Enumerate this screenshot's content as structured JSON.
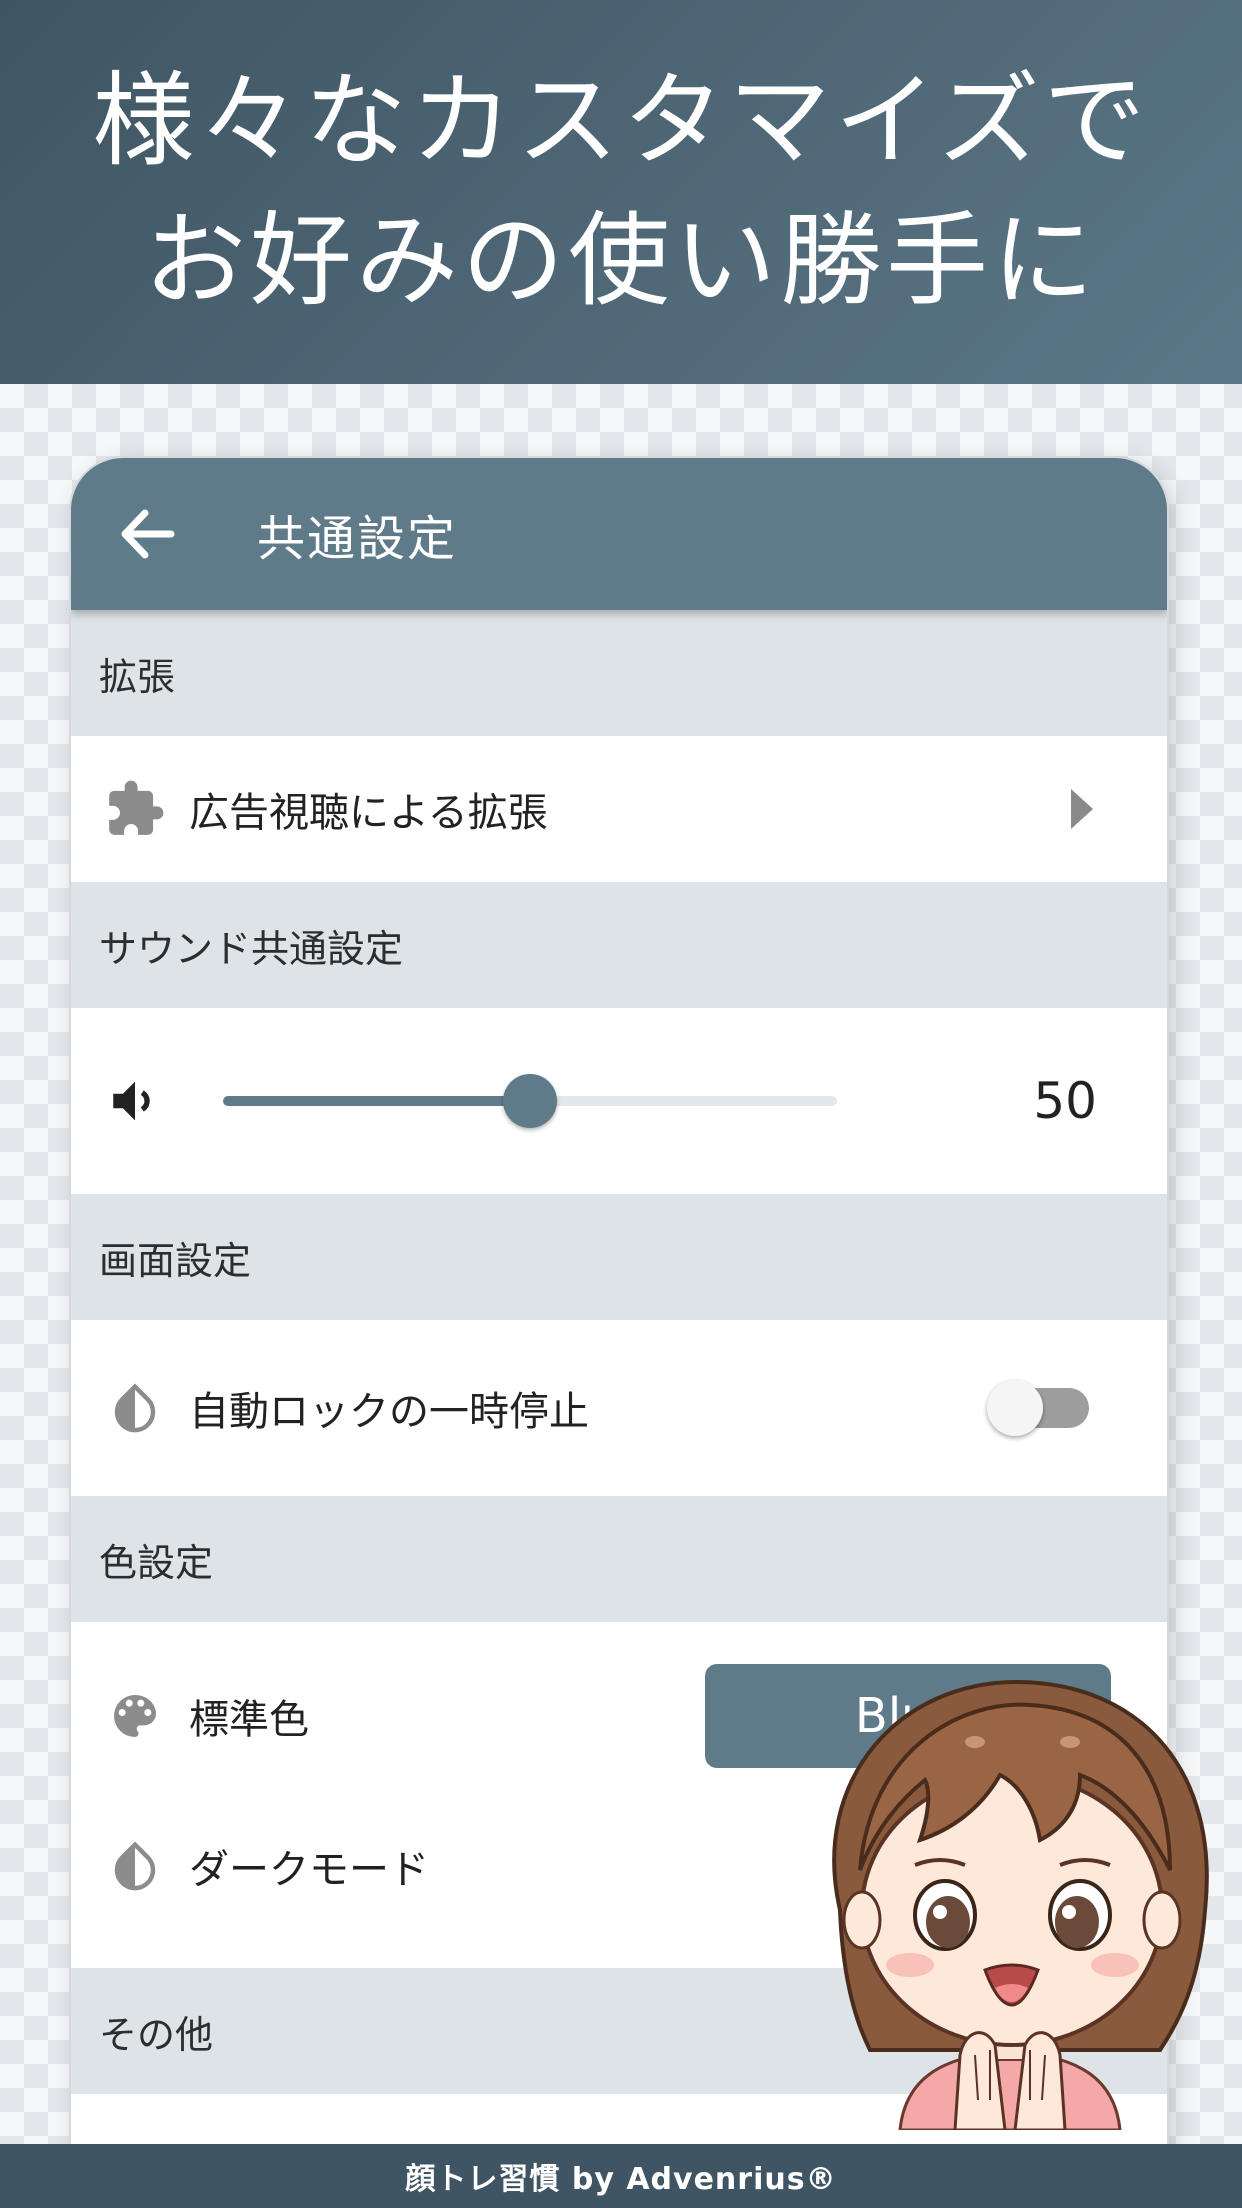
{
  "banner": {
    "line1": "様々なカスタマイズで",
    "line2": "お好みの使い勝手に"
  },
  "appbar": {
    "title": "共通設定",
    "back_icon": "arrow-left-icon"
  },
  "sections": {
    "extension": {
      "header": "拡張",
      "item_label": "広告視聴による拡張",
      "item_icon": "puzzle-icon"
    },
    "sound": {
      "header": "サウンド共通設定",
      "volume_icon": "volume-icon",
      "volume_value": "50",
      "volume_fraction": 0.5
    },
    "screen": {
      "header": "画面設定",
      "item_label": "自動ロックの一時停止",
      "item_icon": "contrast-drop-icon",
      "toggle_on": false
    },
    "color": {
      "header": "色設定",
      "standard_label": "標準色",
      "standard_icon": "palette-icon",
      "standard_value": "Blue",
      "dark_label": "ダークモード",
      "dark_icon": "contrast-drop-icon"
    },
    "other": {
      "header": "その他"
    }
  },
  "colors": {
    "accent": "#5f7b8a",
    "banner": "#4f6877",
    "section_bg": "#dde3e7"
  },
  "footer": {
    "text": "顔トレ習慣 by Advenrius®"
  }
}
